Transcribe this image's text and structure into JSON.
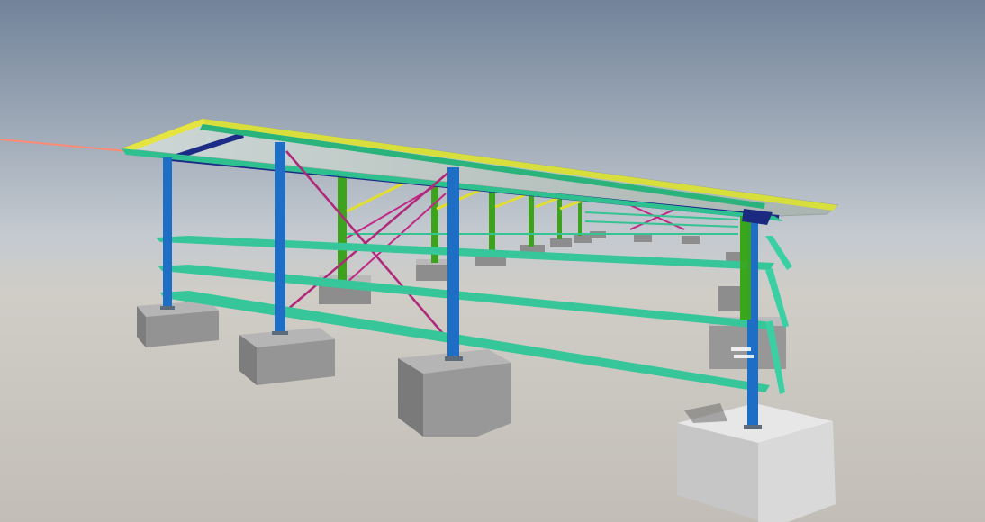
{
  "viewer": {
    "type": "3d-model-viewport",
    "model": "steel-frame-canopy-structure"
  },
  "colors": {
    "sky_top": "#7f8fa6",
    "sky_bottom": "#d6d6d2",
    "ground": "#c6c3bd",
    "column_primary": "#1f6fc4",
    "column_secondary": "#3fa31f",
    "girt": "#3cc8a0",
    "rafter": "#1b2a80",
    "purlin": "#e4e23a",
    "bracing": "#b0287a",
    "roof_sheet": "#bfc7c4",
    "ridge_beam": "#d6342e",
    "footing": "#8f8f8f",
    "axis_line": "#ff7f6e"
  }
}
